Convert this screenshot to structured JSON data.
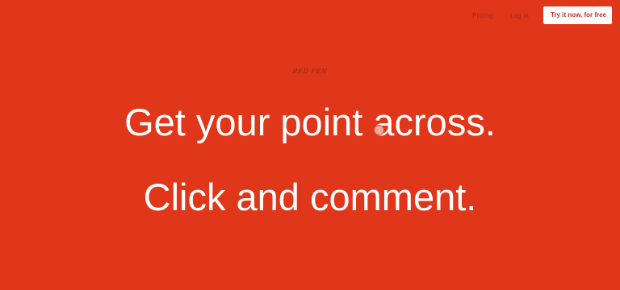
{
  "nav": {
    "links": [
      {
        "label": "Pricing"
      },
      {
        "label": "Log in"
      }
    ],
    "cta_label": "Try it now, for free"
  },
  "brand": {
    "logo_text": "RED PEN"
  },
  "hero": {
    "line1": "Get your point across.",
    "line2": "Click and comment."
  },
  "colors": {
    "background": "#e0361a",
    "cta_background": "#ffffff",
    "cta_text": "#c6301a",
    "nav_text": "#9a2a17",
    "comment_marker": "#f2a891"
  }
}
